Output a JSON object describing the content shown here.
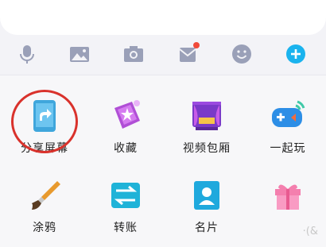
{
  "toolbar": {
    "icons": [
      "microphone-icon",
      "image-icon",
      "camera-icon",
      "red-packet-icon",
      "emoji-icon",
      "plus-icon"
    ],
    "notification_dot_color": "#f04a3a",
    "plus_color": "#1ab3ee"
  },
  "grid": {
    "items": [
      {
        "label": "分享屏幕",
        "icon": "share-screen-icon",
        "highlighted": true
      },
      {
        "label": "收藏",
        "icon": "favorites-icon"
      },
      {
        "label": "视频包厢",
        "icon": "video-box-icon"
      },
      {
        "label": "一起玩",
        "icon": "play-together-icon"
      },
      {
        "label": "涂鸦",
        "icon": "graffiti-icon"
      },
      {
        "label": "转账",
        "icon": "transfer-icon"
      },
      {
        "label": "名片",
        "icon": "business-card-icon"
      },
      {
        "label": "",
        "icon": "gift-icon"
      }
    ],
    "highlight_color": "#d9322c"
  },
  "watermark": "·(&"
}
